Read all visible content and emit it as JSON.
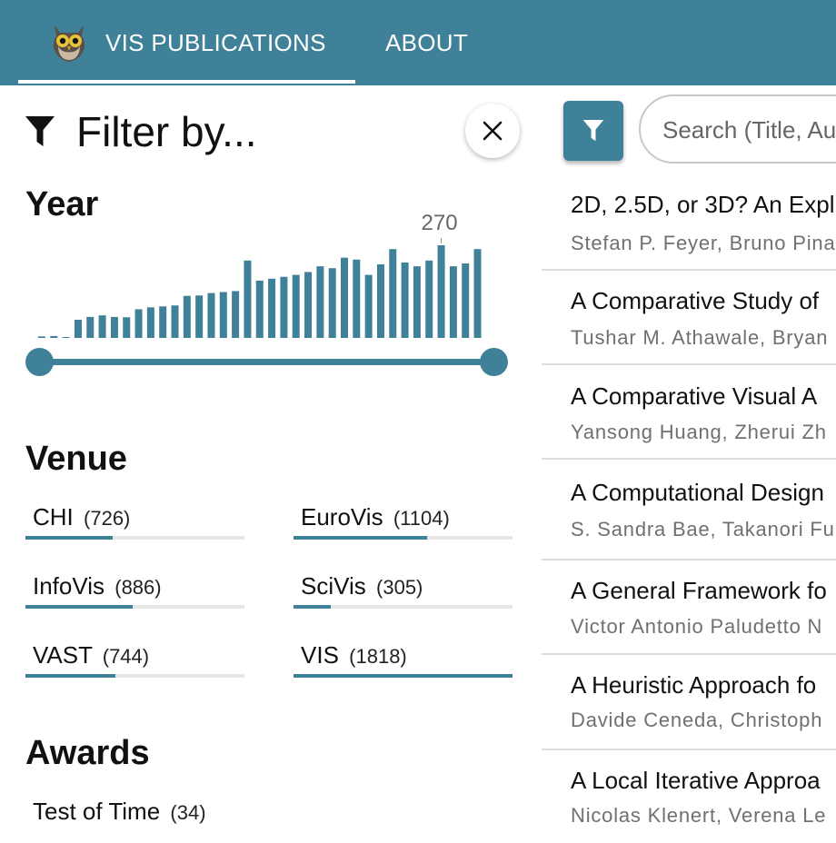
{
  "nav": {
    "home_label": "VIS PUBLICATIONS",
    "about_label": "ABOUT"
  },
  "filter": {
    "title": "Filter by...",
    "year": {
      "title": "Year",
      "max_label": "270",
      "counts": [
        8,
        10,
        0,
        95,
        110,
        118,
        110,
        108,
        150,
        160,
        165,
        170,
        220,
        222,
        235,
        240,
        245,
        405,
        300,
        310,
        320,
        330,
        345,
        375,
        365,
        420,
        410,
        330,
        385,
        465,
        395,
        375,
        405,
        485,
        375,
        390,
        465
      ]
    },
    "venue": {
      "title": "Venue",
      "items": [
        {
          "name": "CHI",
          "count": "(726)",
          "fraction": 0.4
        },
        {
          "name": "EuroVis",
          "count": "(1104)",
          "fraction": 0.61
        },
        {
          "name": "InfoVis",
          "count": "(886)",
          "fraction": 0.49
        },
        {
          "name": "SciVis",
          "count": "(305)",
          "fraction": 0.17
        },
        {
          "name": "VAST",
          "count": "(744)",
          "fraction": 0.41
        },
        {
          "name": "VIS",
          "count": "(1818)",
          "fraction": 1.0
        }
      ]
    },
    "awards": {
      "title": "Awards",
      "items": [
        {
          "name": "Test of Time",
          "count": "(34)"
        }
      ]
    }
  },
  "search": {
    "placeholder": "Search (Title, Au"
  },
  "papers": [
    {
      "title": "2D, 2.5D, or 3D? An Expl",
      "authors": "Stefan P. Feyer, Bruno Pina"
    },
    {
      "title": "A Comparative Study of",
      "authors": "Tushar M. Athawale, Bryan"
    },
    {
      "title": "A Comparative Visual A",
      "authors": "Yansong Huang, Zherui Zh"
    },
    {
      "title": "A Computational Design",
      "authors": "S. Sandra Bae, Takanori Fu"
    },
    {
      "title": "A General Framework fo",
      "authors": "Victor Antonio Paludetto N"
    },
    {
      "title": "A Heuristic Approach fo",
      "authors": "Davide Ceneda, Christoph"
    },
    {
      "title": "A Local Iterative Approa",
      "authors": "Nicolas Klenert, Verena Le"
    }
  ],
  "colors": {
    "accent": "#3f8199",
    "track": "#e6e6e6"
  },
  "icons": {
    "logo": "owl-logo-icon",
    "filter": "funnel-icon",
    "close": "close-icon"
  }
}
